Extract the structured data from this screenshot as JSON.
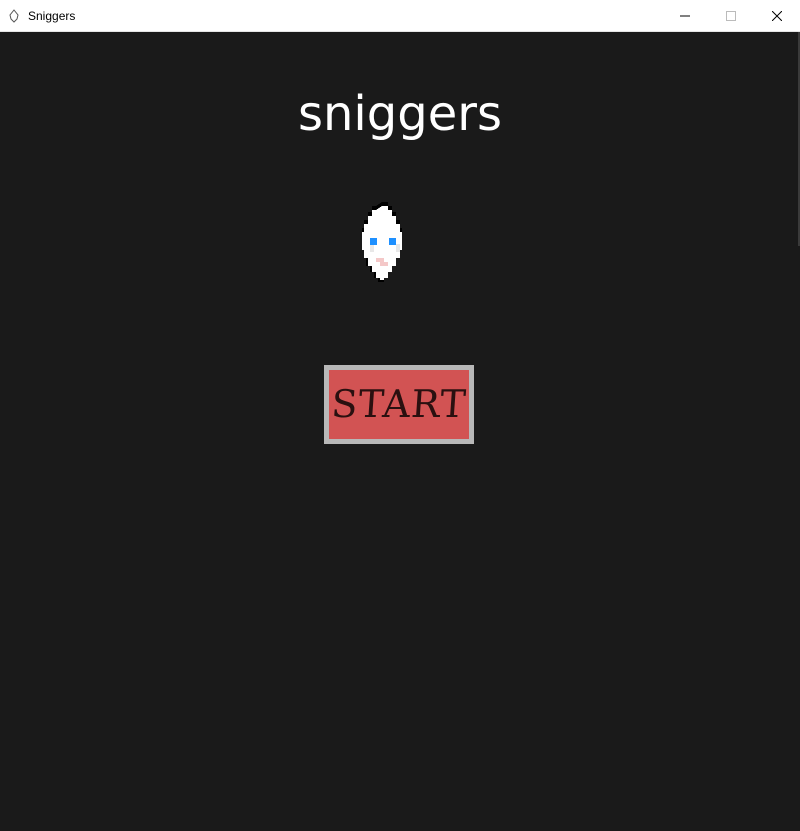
{
  "window": {
    "title": "Sniggers",
    "controls": {
      "minimize": "minimize-icon",
      "maximize": "maximize-icon",
      "close": "close-icon"
    }
  },
  "game": {
    "title": "sniggers",
    "start_label": "START",
    "character": "ghost-sprite"
  },
  "colors": {
    "background": "#1a1a1a",
    "title_text": "#ffffff",
    "button_fill": "#d25353",
    "button_border": "#b8b8b8",
    "button_text": "#2a1010",
    "sprite_eyes": "#1e90ff"
  }
}
